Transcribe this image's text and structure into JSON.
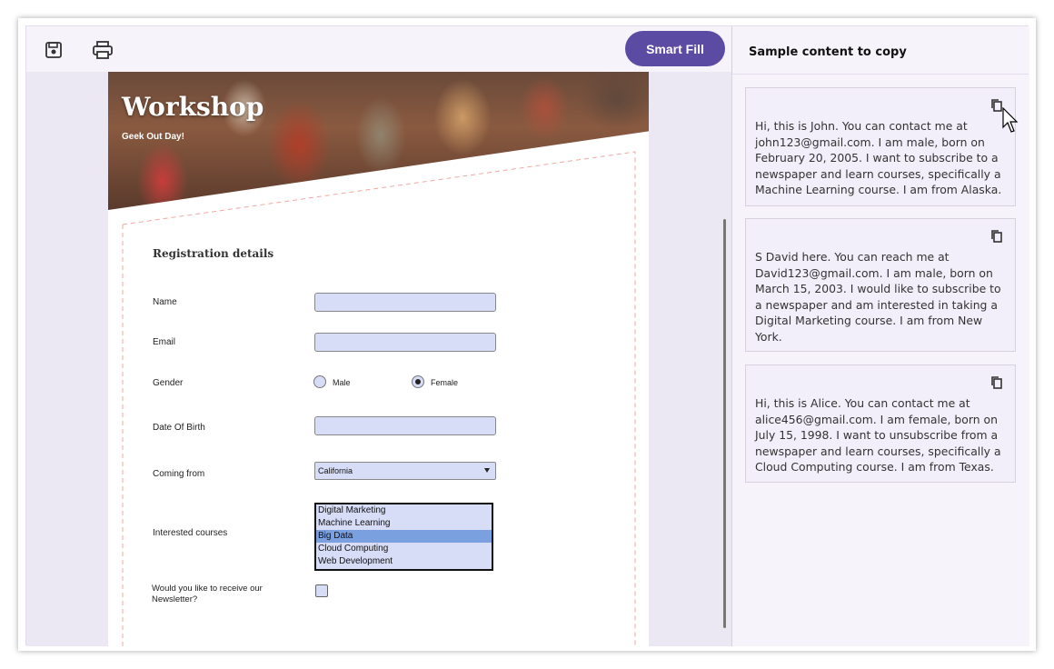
{
  "toolbar": {
    "save_icon": "save-icon",
    "print_icon": "print-icon",
    "smart_fill_label": "Smart Fill"
  },
  "form": {
    "banner_title": "Workshop",
    "banner_subtitle": "Geek Out Day!",
    "section_title": "Registration details",
    "name_label": "Name",
    "name_value": "",
    "email_label": "Email",
    "email_value": "",
    "gender_label": "Gender",
    "gender_options": [
      "Male",
      "Female"
    ],
    "gender_selected": "Female",
    "dob_label": "Date Of Birth",
    "dob_value": "",
    "coming_from_label": "Coming from",
    "coming_from_value": "California",
    "courses_label": "Interested courses",
    "courses": [
      "Digital Marketing",
      "Machine Learning",
      "Big Data",
      "Cloud Computing",
      "Web Development"
    ],
    "courses_selected": "Big Data",
    "newsletter_label_line1": "Would you like to receive our",
    "newsletter_label_line2": "Newsletter?",
    "newsletter_checked": false
  },
  "sidebar": {
    "title": "Sample content to copy",
    "cards": [
      {
        "text": "Hi, this is John. You can contact me at john123@gmail.com. I am male, born on February 20, 2005. I want to subscribe to a newspaper and learn courses, specifically a Machine Learning course. I am from Alaska."
      },
      {
        "text": "S David here. You can reach me at David123@gmail.com. I am male, born on March 15, 2003. I would like to subscribe to a newspaper and am interested in taking a Digital Marketing course. I am from New York."
      },
      {
        "text": "Hi, this is Alice. You can contact me at alice456@gmail.com. I am female, born on July 15, 1998. I want to unsubscribe from a newspaper and learn courses, specifically a Cloud Computing course. I am from Texas."
      }
    ]
  },
  "colors": {
    "accent": "#5b4ba3",
    "field_bg": "#d7ddf7",
    "list_selected": "#7aa0e0",
    "dashed_border": "#f0a8a0"
  }
}
